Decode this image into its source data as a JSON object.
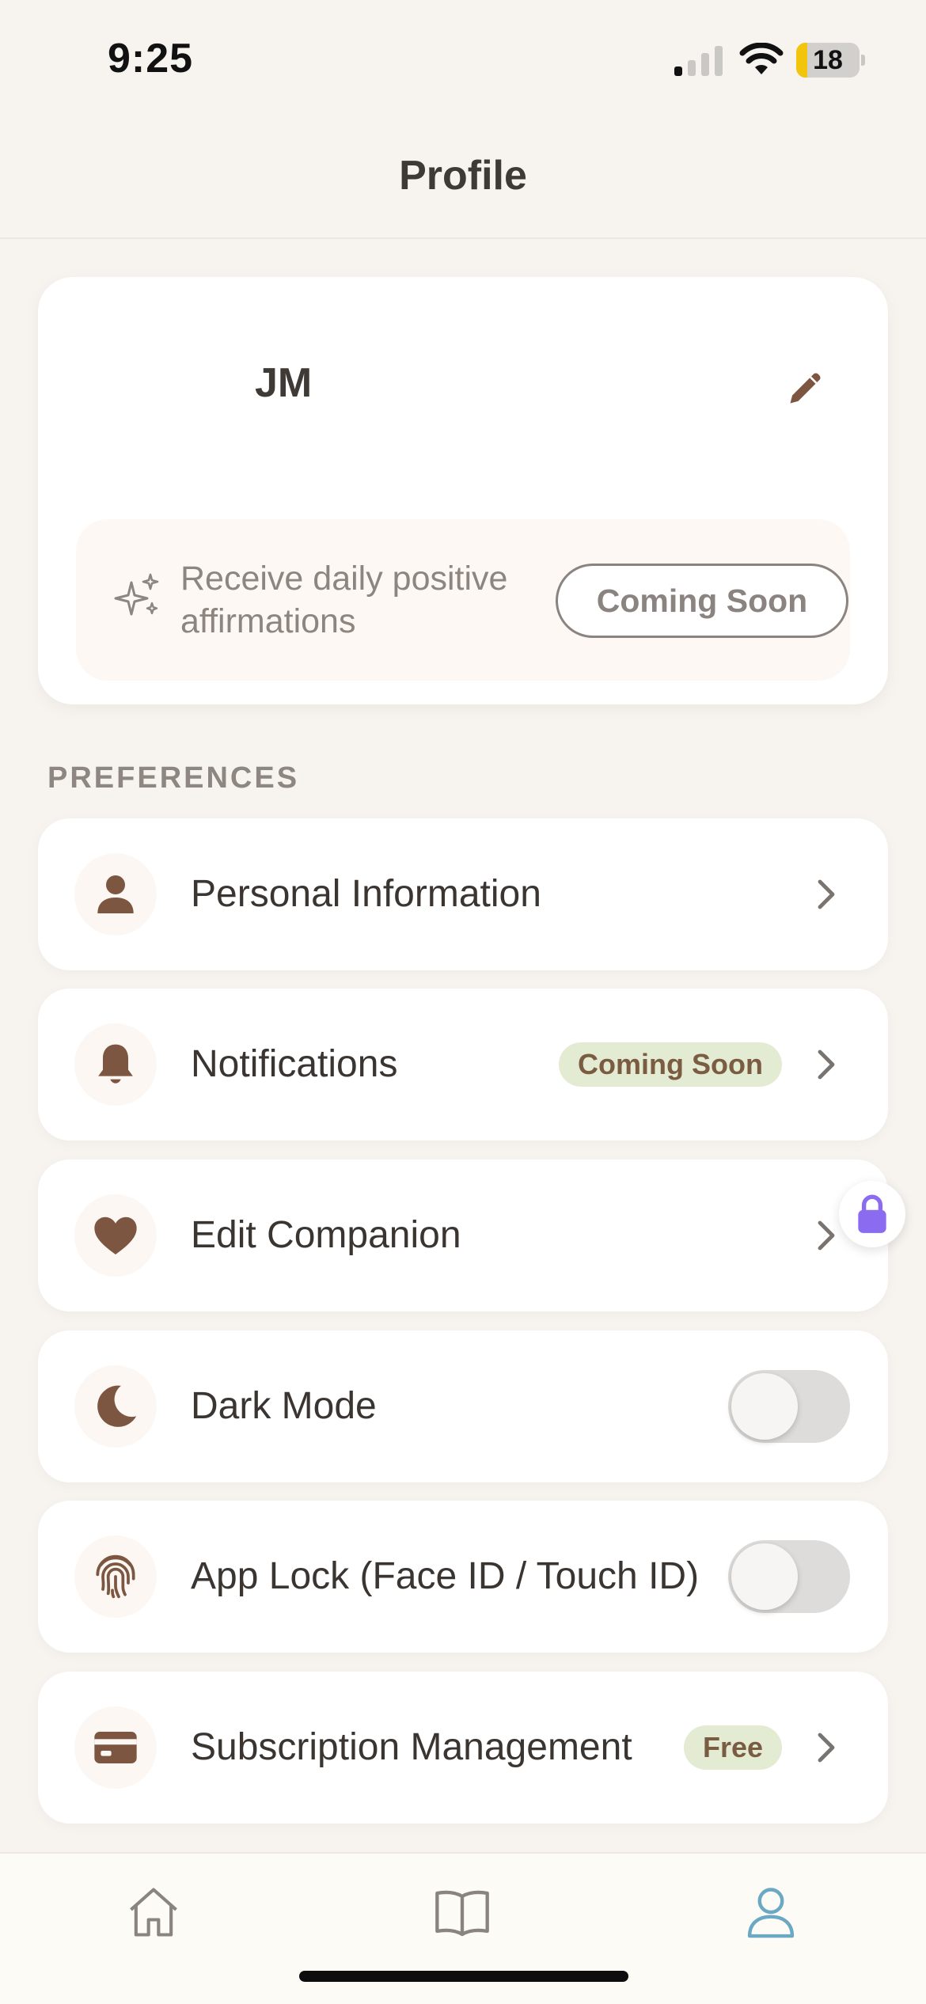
{
  "status_bar": {
    "time": "9:25",
    "battery_level": "18",
    "battery_fraction": 0.18
  },
  "header": {
    "title": "Profile"
  },
  "profile": {
    "initials": "JM",
    "affirmation_text": "Receive daily positive affirmations",
    "affirmation_button": "Coming Soon"
  },
  "preferences": {
    "section_label": "PREFERENCES",
    "items": [
      {
        "label": "Personal Information",
        "icon": "person-icon"
      },
      {
        "label": "Notifications",
        "icon": "bell-icon",
        "badge": "Coming Soon"
      },
      {
        "label": "Edit Companion",
        "icon": "heart-icon"
      },
      {
        "label": "Dark Mode",
        "icon": "moon-icon",
        "toggle_on": false
      },
      {
        "label": "App Lock (Face ID / Touch ID)",
        "icon": "fingerprint-icon",
        "toggle_on": false
      },
      {
        "label": "Subscription Management",
        "icon": "credit-card-icon",
        "badge": "Free"
      }
    ]
  },
  "tab_bar": {
    "tabs": [
      {
        "icon": "home-icon",
        "active": false
      },
      {
        "icon": "book-icon",
        "active": false
      },
      {
        "icon": "profile-icon",
        "active": true
      }
    ]
  },
  "colors": {
    "background": "#f7f4f0",
    "icon_brown": "#7c5641",
    "badge_green": "#e3ebd3",
    "active_tab": "#6aa8c4",
    "lock_purple": "#8b6cf0"
  }
}
